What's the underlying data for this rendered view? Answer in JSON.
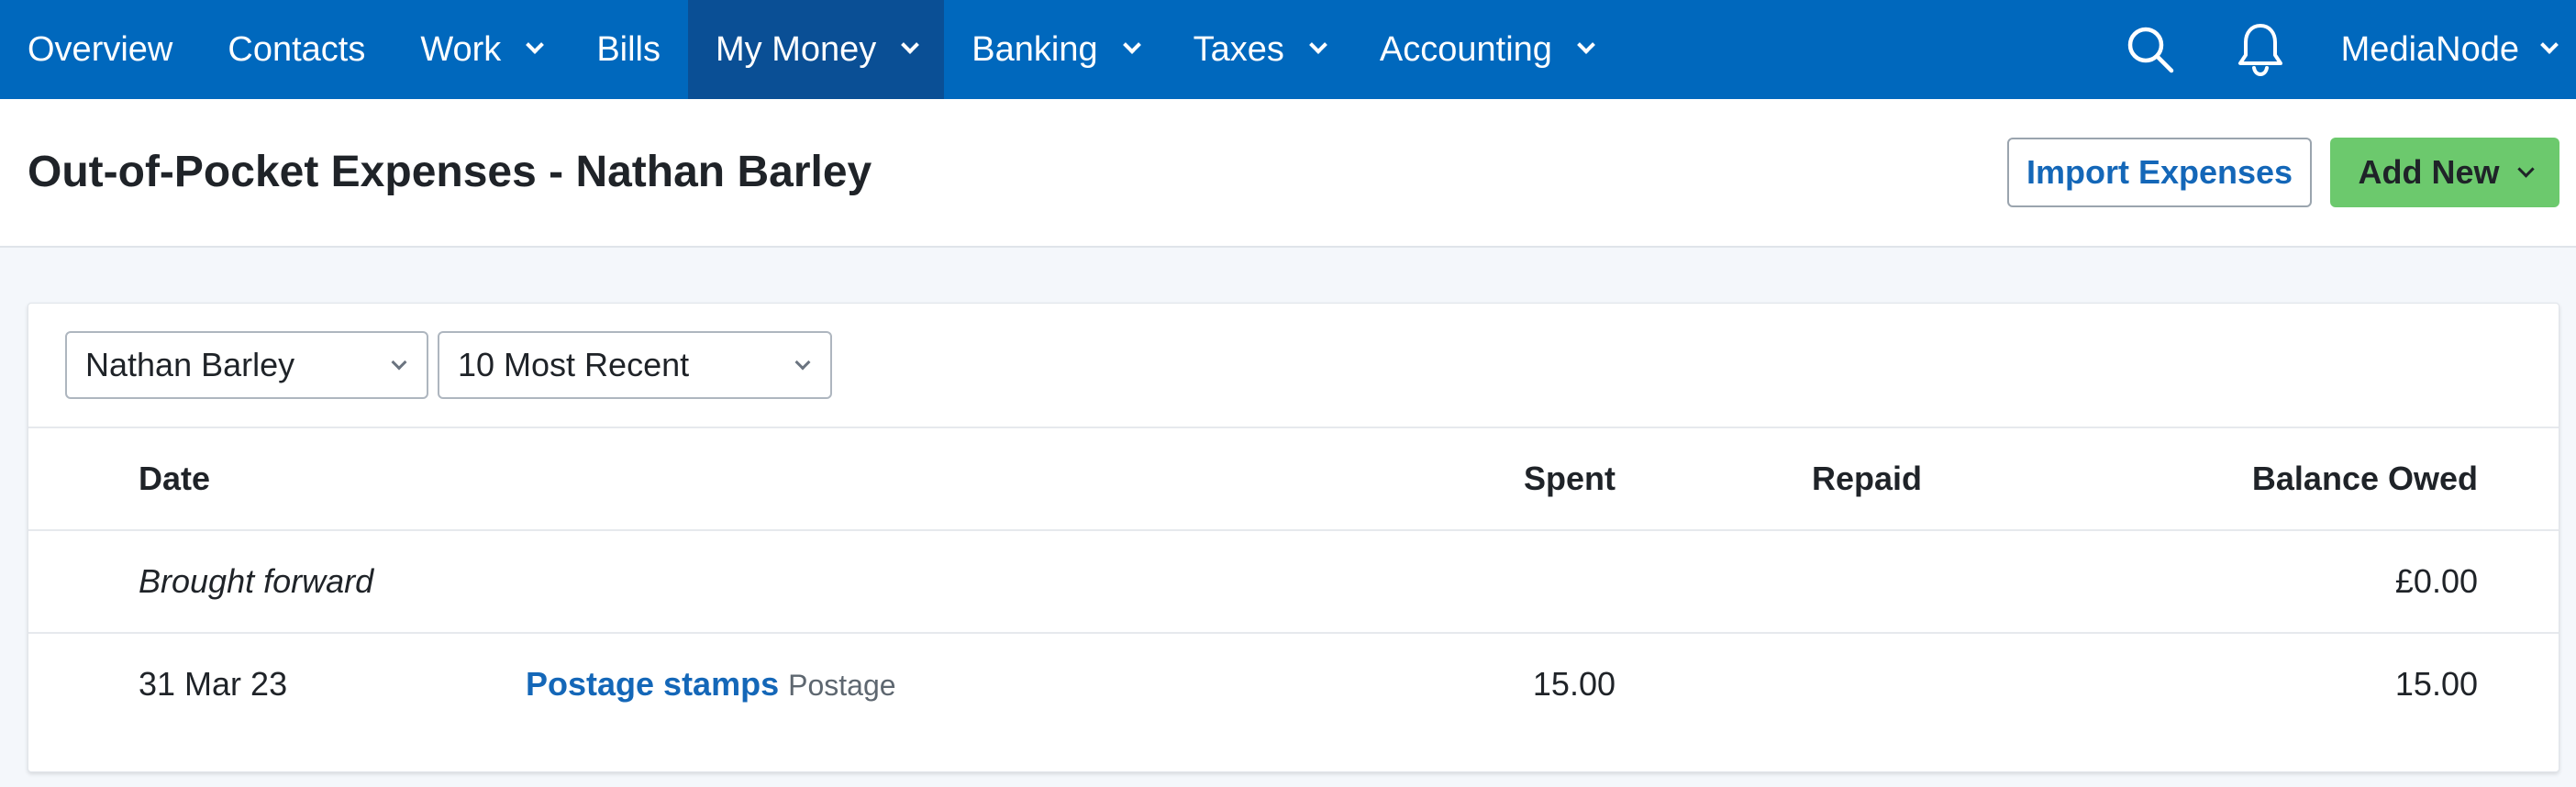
{
  "nav": {
    "items": [
      {
        "label": "Overview",
        "dropdown": false
      },
      {
        "label": "Contacts",
        "dropdown": false
      },
      {
        "label": "Work",
        "dropdown": true
      },
      {
        "label": "Bills",
        "dropdown": false
      },
      {
        "label": "My Money",
        "dropdown": true,
        "active": true
      },
      {
        "label": "Banking",
        "dropdown": true
      },
      {
        "label": "Taxes",
        "dropdown": true
      },
      {
        "label": "Accounting",
        "dropdown": true
      }
    ],
    "search_icon": "search-icon",
    "notifications_icon": "bell-icon",
    "user_label": "MediaNode",
    "colors": {
      "nav_bg": "#0068bd",
      "active_bg": "#0a4f95"
    }
  },
  "header": {
    "title": "Out-of-Pocket Expenses - Nathan Barley",
    "import_label": "Import Expenses",
    "add_new_label": "Add New",
    "colors": {
      "link": "#1467b8",
      "add_new_bg": "#6cc96d"
    }
  },
  "filters": {
    "user": "Nathan Barley",
    "range": "10 Most Recent"
  },
  "table": {
    "headers": {
      "date": "Date",
      "spent": "Spent",
      "repaid": "Repaid",
      "balance": "Balance Owed"
    },
    "brought_forward": {
      "label": "Brought forward",
      "balance": "£0.00"
    },
    "rows": [
      {
        "date": "31 Mar 23",
        "description": "Postage stamps",
        "category": "Postage",
        "spent": "15.00",
        "repaid": "",
        "balance": "15.00"
      }
    ]
  }
}
